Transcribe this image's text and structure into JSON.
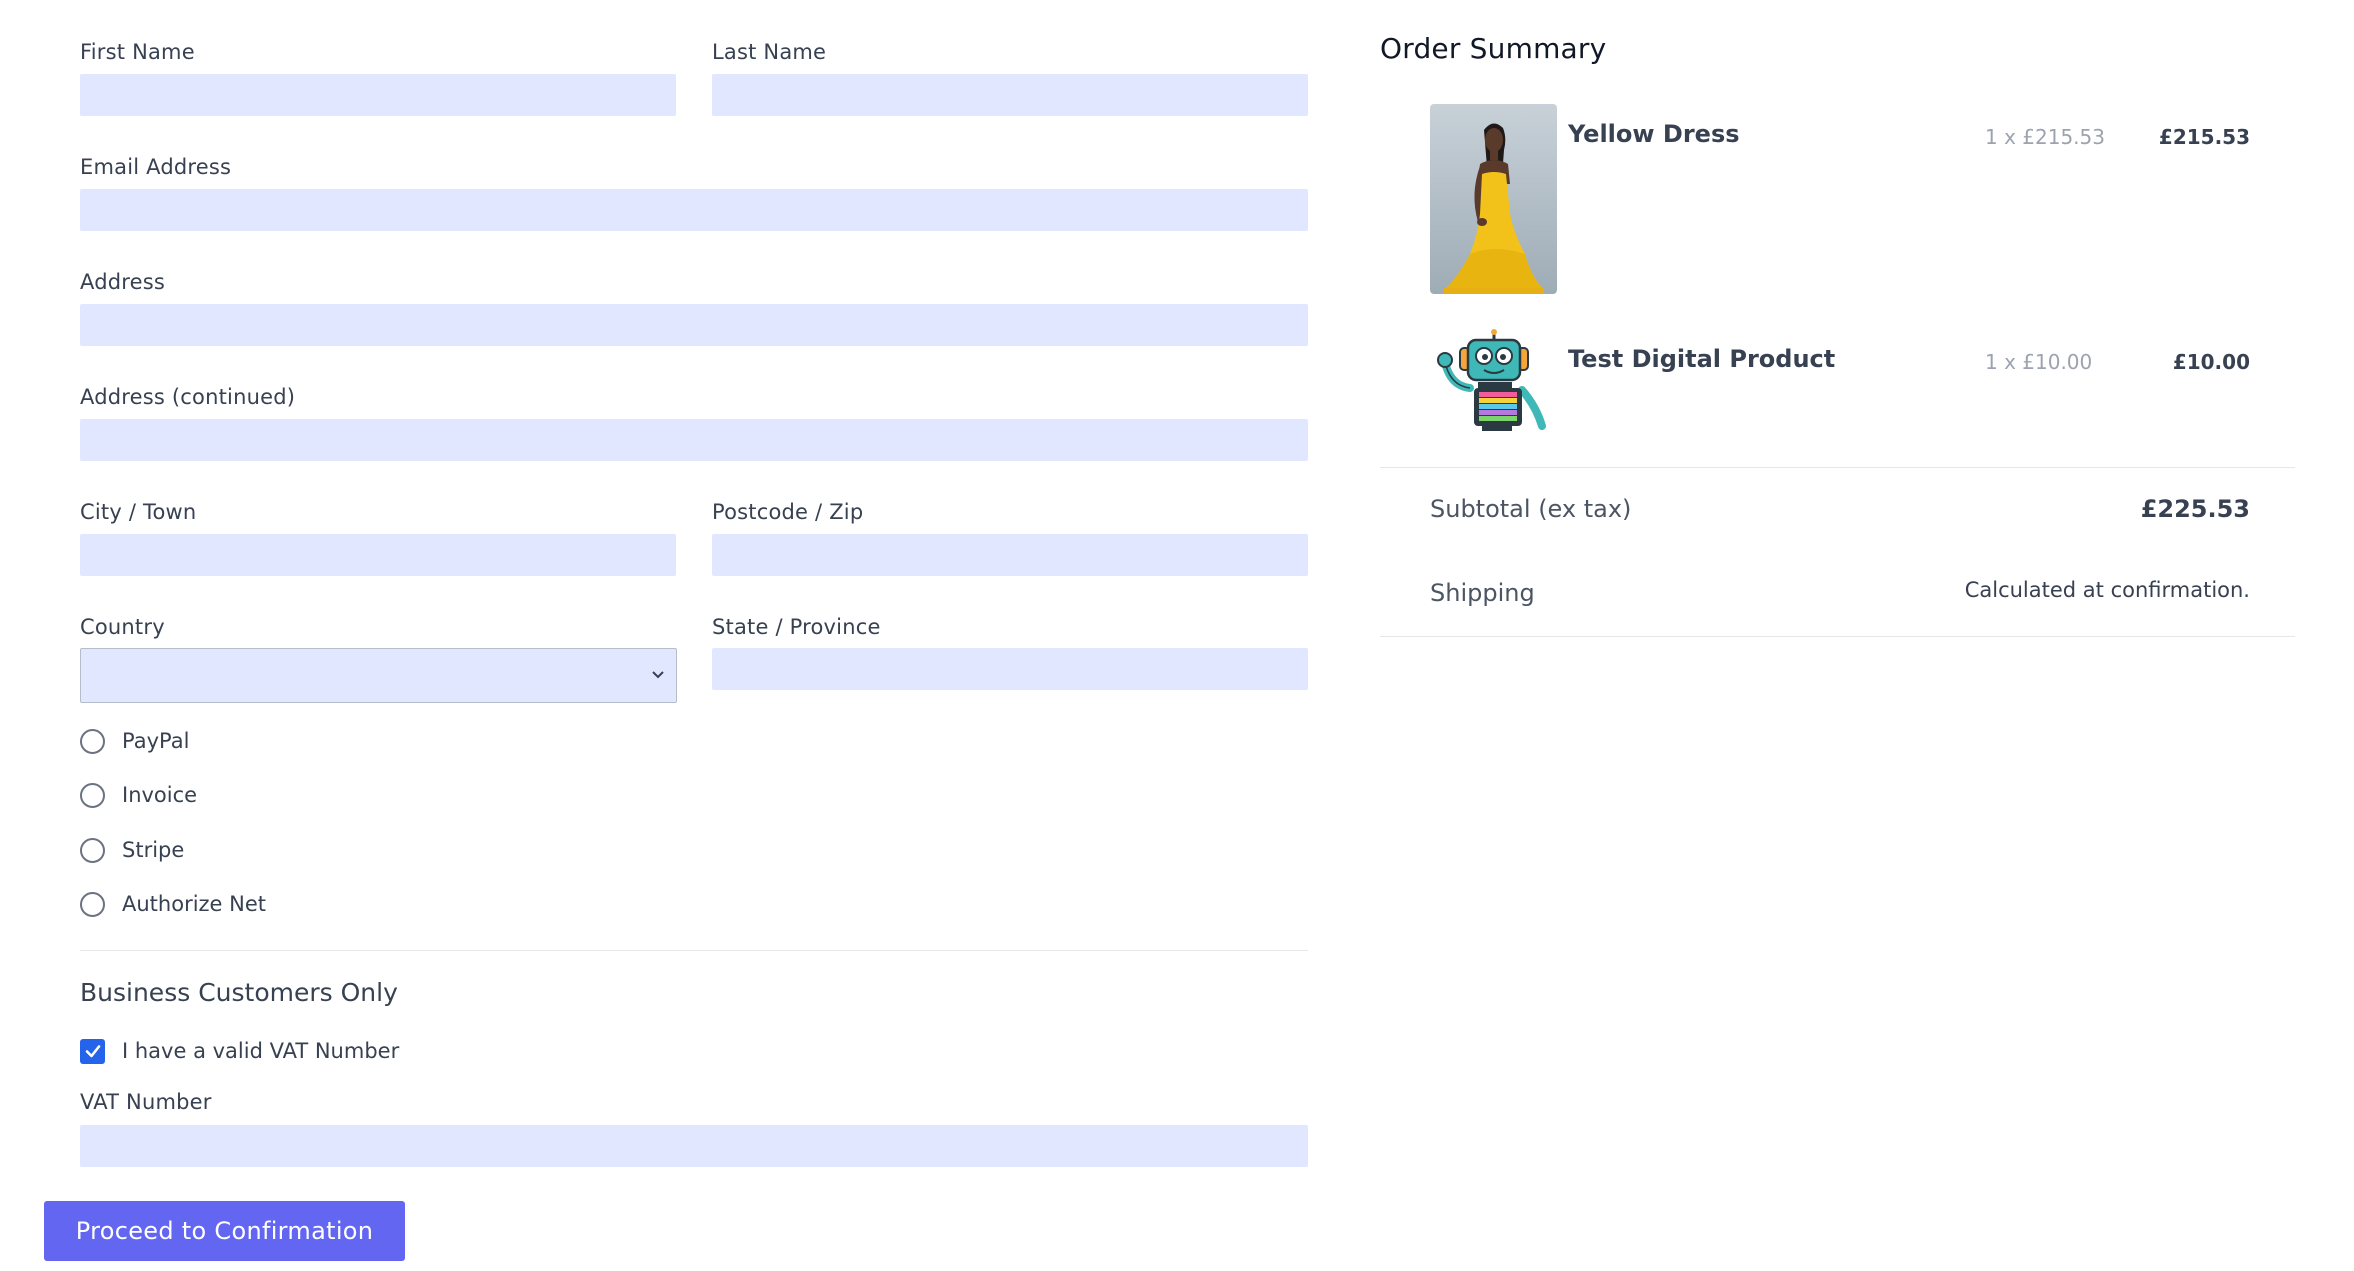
{
  "form": {
    "first_name": {
      "label": "First Name",
      "value": ""
    },
    "last_name": {
      "label": "Last Name",
      "value": ""
    },
    "email": {
      "label": "Email Address",
      "value": ""
    },
    "address": {
      "label": "Address",
      "value": ""
    },
    "address2": {
      "label": "Address (continued)",
      "value": ""
    },
    "city": {
      "label": "City / Town",
      "value": ""
    },
    "postcode": {
      "label": "Postcode / Zip",
      "value": ""
    },
    "country": {
      "label": "Country",
      "selected": ""
    },
    "state": {
      "label": "State / Province",
      "value": ""
    },
    "payment_methods": [
      {
        "label": "PayPal",
        "selected": false
      },
      {
        "label": "Invoice",
        "selected": false
      },
      {
        "label": "Stripe",
        "selected": false
      },
      {
        "label": "Authorize Net",
        "selected": false
      }
    ],
    "business": {
      "heading": "Business Customers Only",
      "vat_checkbox_label": "I have a valid VAT Number",
      "vat_checked": true,
      "vat_number_label": "VAT Number",
      "vat_number_value": ""
    },
    "proceed_label": "Proceed to Confirmation"
  },
  "summary": {
    "title": "Order Summary",
    "items": [
      {
        "name": "Yellow Dress",
        "qty": "1 x £215.53",
        "price": "£215.53",
        "image": "woman-in-yellow-dress-photo"
      },
      {
        "name": "Test Digital Product",
        "qty": "1 x £10.00",
        "price": "£10.00",
        "image": "robot-mascot-illustration"
      }
    ],
    "subtotal_label": "Subtotal (ex tax)",
    "subtotal_value": "£225.53",
    "shipping_label": "Shipping",
    "shipping_value": "Calculated at confirmation."
  },
  "colors": {
    "input_bg": "#e0e7ff",
    "button_bg": "#6366f1",
    "checkbox_bg": "#2563eb"
  }
}
